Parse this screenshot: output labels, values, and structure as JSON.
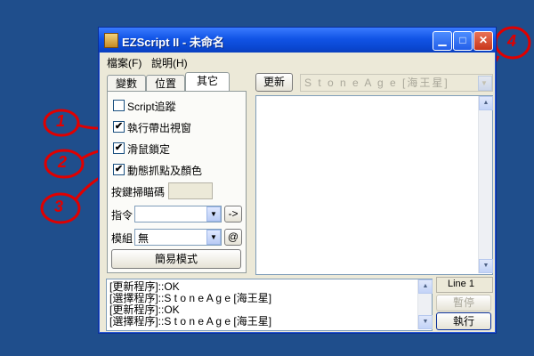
{
  "window": {
    "title": "EZScript II - 未命名",
    "controls": {
      "minimize": "▁",
      "maximize": "□",
      "close": "✕"
    }
  },
  "menu": [
    "檔案(F)",
    "說明(H)"
  ],
  "tabs": [
    "變數",
    "位置",
    "其它"
  ],
  "active_tab": "其它",
  "options": [
    {
      "label": "Script追蹤",
      "checked": false
    },
    {
      "label": "執行帶出視窗",
      "checked": true
    },
    {
      "label": "滑鼠鎖定",
      "checked": true
    },
    {
      "label": "動態抓點及顏色",
      "checked": true
    }
  ],
  "scan_code_label": "按鍵掃瞄碼",
  "command": {
    "label": "指令",
    "value": "",
    "go_button": "->"
  },
  "module": {
    "label": "模組",
    "value": "無",
    "at_button": "@"
  },
  "simple_mode_button": "簡易模式",
  "update_button": "更新",
  "target_window": "S t o n e A g e  [海王星]",
  "log_lines": [
    "[更新程序]::OK",
    "[選擇程序]::S t o n e A g e  [海王星]",
    "[更新程序]::OK",
    "[選擇程序]::S t o n e A g e  [海王星]"
  ],
  "line_indicator": "Line 1",
  "pause_button": "暫停",
  "run_button": "執行",
  "annotations": [
    "1",
    "2",
    "3",
    "4"
  ],
  "colors": {
    "desktop": "#1f4e8c",
    "titlebar": "#0a47d1",
    "annotation": "#e00000",
    "window_bg": "#ece9d8"
  }
}
